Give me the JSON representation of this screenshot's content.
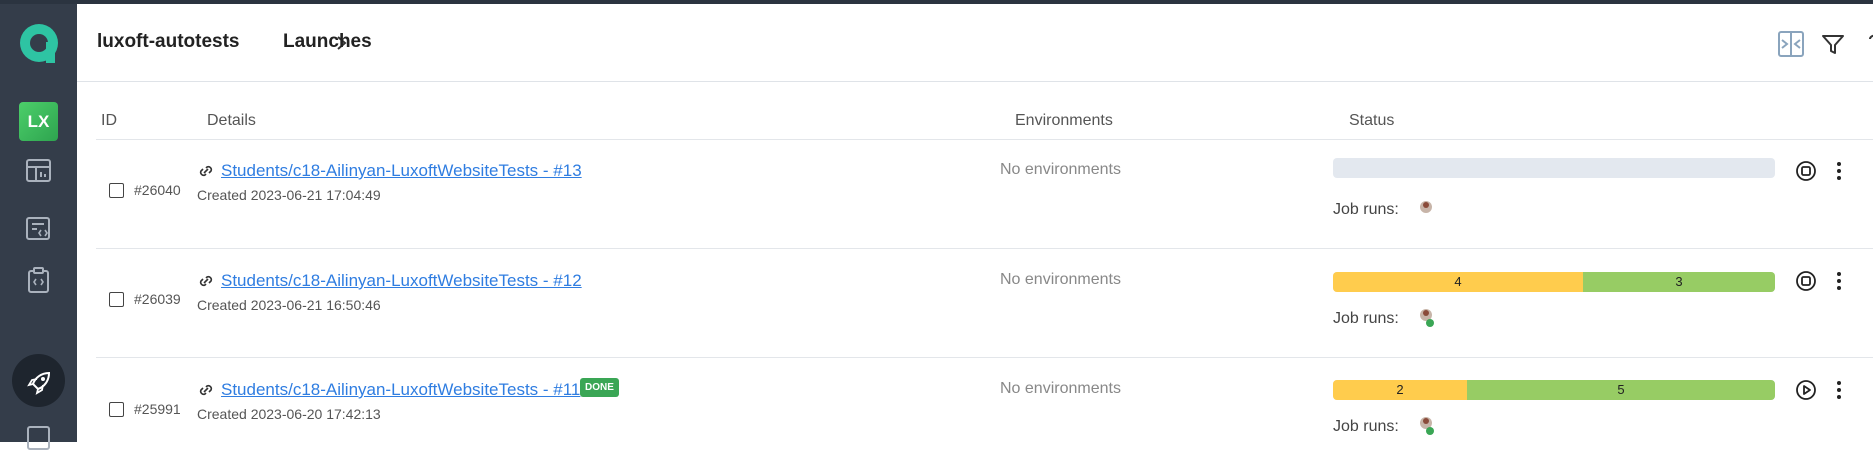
{
  "header": {
    "project": "luxoft-autotests",
    "page": "Launches"
  },
  "sidebar": {
    "avatar_initials": "LX"
  },
  "columns": {
    "id": "ID",
    "details": "Details",
    "environments": "Environments",
    "status": "Status"
  },
  "rows": [
    {
      "id": "#26040",
      "title": "Students/c18-Ailinyan-LuxoftWebsiteTests - #13",
      "created": "Created 2023-06-21 17:04:49",
      "environment": "No environments",
      "job_runs_label": "Job runs:",
      "status": {
        "yellow": null,
        "green": null
      },
      "action": "stop"
    },
    {
      "id": "#26039",
      "title": "Students/c18-Ailinyan-LuxoftWebsiteTests - #12",
      "created": "Created 2023-06-21 16:50:46",
      "environment": "No environments",
      "job_runs_label": "Job runs:",
      "status": {
        "yellow": "4",
        "green": "3"
      },
      "action": "stop"
    },
    {
      "id": "#25991",
      "title": "Students/c18-Ailinyan-LuxoftWebsiteTests - #11",
      "badge": "DONE",
      "created": "Created 2023-06-20 17:42:13",
      "environment": "No environments",
      "job_runs_label": "Job runs:",
      "status": {
        "yellow": "2",
        "green": "5"
      },
      "action": "play"
    }
  ],
  "colors": {
    "sidebar": "#343d4a",
    "accent": "#2f7de1",
    "passed": "#97cc64",
    "warning": "#ffcc4d",
    "done": "#3aa655"
  }
}
